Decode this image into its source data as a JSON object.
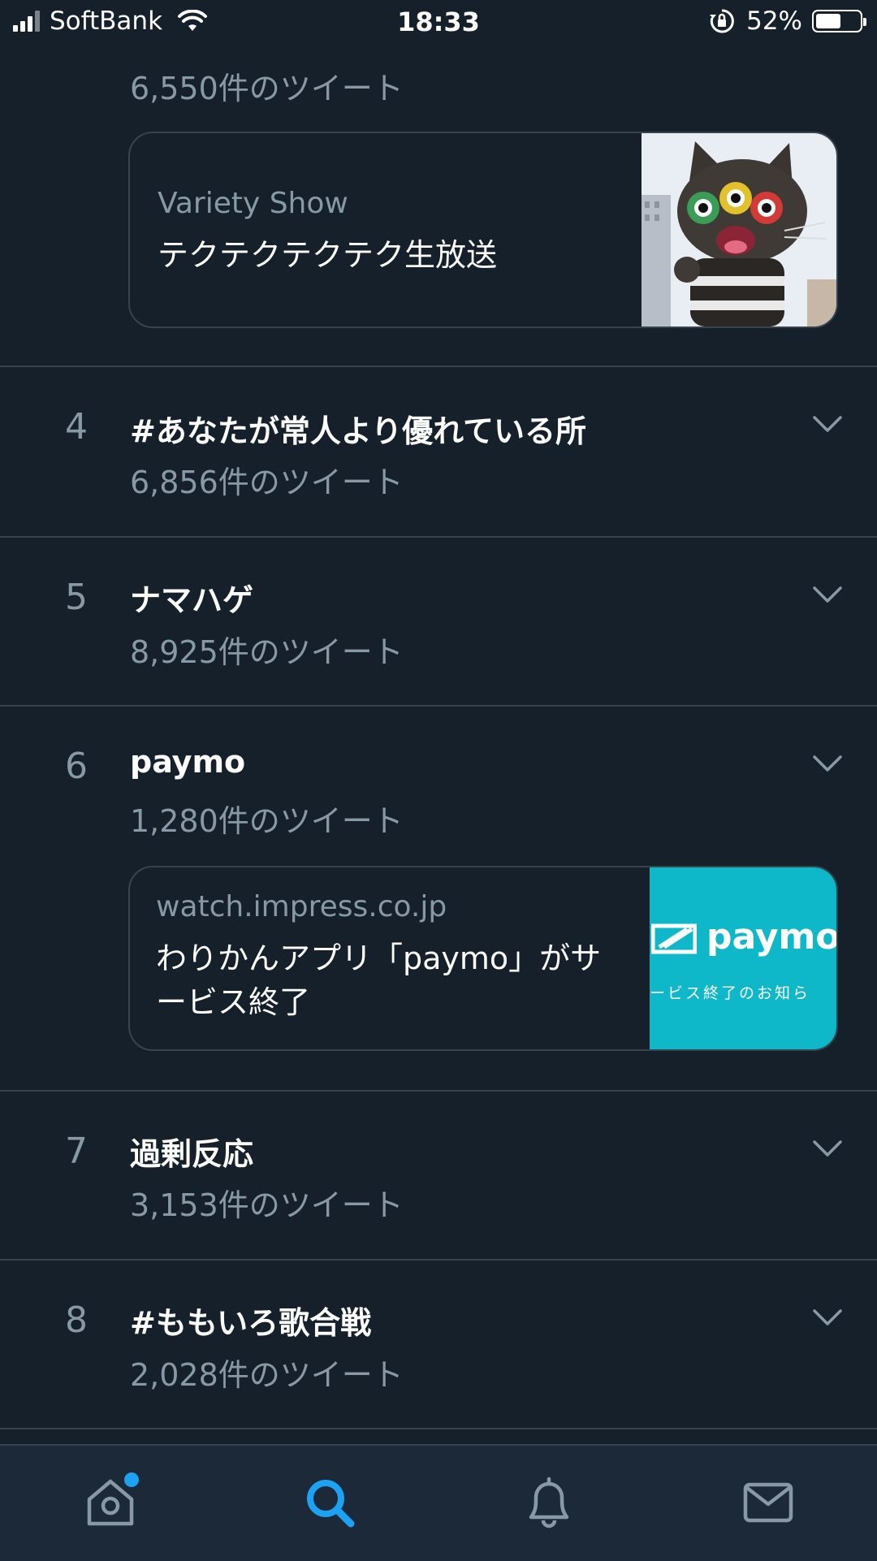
{
  "status_bar": {
    "carrier": "SoftBank",
    "time": "18:33",
    "battery_percent": "52%",
    "battery_level": 0.52
  },
  "trend3": {
    "count": "6,550件のツイート",
    "card": {
      "category": "Variety Show",
      "title": "テクテクテクテク生放送"
    }
  },
  "trends": [
    {
      "rank": "4",
      "title": "#あなたが常人より優れている所",
      "count": "6,856件のツイート"
    },
    {
      "rank": "5",
      "title": "ナマハゲ",
      "count": "8,925件のツイート"
    },
    {
      "rank": "6",
      "title": "paymo",
      "count": "1,280件のツイート",
      "card": {
        "source": "watch.impress.co.jp",
        "title_line1": "わりかんアプリ「paymo」がサ",
        "title_line2": "ービス終了",
        "thumb_brand": "paymo",
        "thumb_caption": "ービス終了のお知ら"
      }
    },
    {
      "rank": "7",
      "title": "過剰反応",
      "count": "3,153件のツイート"
    },
    {
      "rank": "8",
      "title": "#ももいろ歌合戦",
      "count": "2,028件のツイート"
    }
  ],
  "tabbar": {
    "items": [
      "home",
      "search",
      "notifications",
      "messages"
    ],
    "active": "search",
    "accent": "#1da1f2"
  }
}
